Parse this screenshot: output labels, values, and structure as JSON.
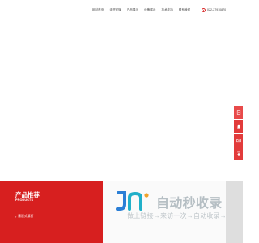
{
  "nav": {
    "items": [
      {
        "label": "网站首页"
      },
      {
        "label": "走进宏辉"
      },
      {
        "label": "产品展示"
      },
      {
        "label": "设备展示"
      },
      {
        "label": "技术支持"
      },
      {
        "label": "联系我们"
      }
    ]
  },
  "contact": {
    "phone": "022-27910870"
  },
  "float_bar": {
    "icons": [
      "document-icon",
      "qq-icon",
      "mail-icon",
      "top-arrow-icon"
    ],
    "color": "#e23b3b"
  },
  "products": {
    "title": "产品推荐",
    "subtitle": "PRODUCTS",
    "link_label": "膨胀式螺钉",
    "block_color": "#d71f1f"
  },
  "watermark": {
    "title": "自动秒收录",
    "subtitle": "做上链接→来访一次→自动收录→"
  }
}
